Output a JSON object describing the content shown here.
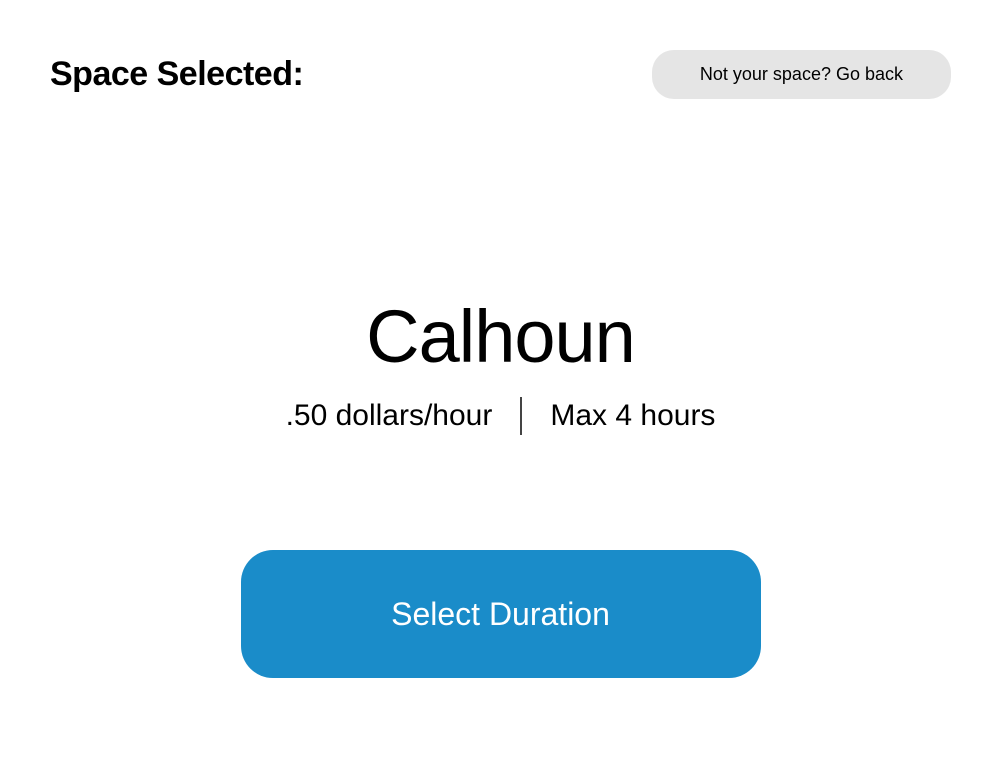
{
  "header": {
    "title": "Space Selected:",
    "go_back_label": "Not your space? Go back"
  },
  "space": {
    "name": "Calhoun",
    "rate": ".50 dollars/hour",
    "max_time": "Max 4 hours"
  },
  "actions": {
    "select_duration_label": "Select Duration"
  },
  "colors": {
    "primary": "#1a8cc9",
    "secondary": "#e5e5e5"
  }
}
